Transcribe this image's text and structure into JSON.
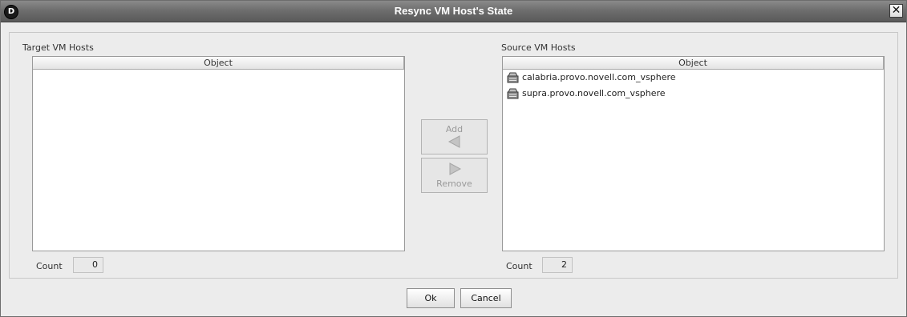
{
  "window": {
    "title": "Resync VM Host's State",
    "app_icon_letter": "D"
  },
  "target": {
    "label": "Target VM Hosts",
    "column_header": "Object",
    "items": [],
    "count_label": "Count",
    "count_value": "0"
  },
  "source": {
    "label": "Source VM Hosts",
    "column_header": "Object",
    "items": [
      {
        "label": "calabria.provo.novell.com_vsphere",
        "icon": "vm-host-icon"
      },
      {
        "label": "supra.provo.novell.com_vsphere",
        "icon": "vm-host-icon"
      }
    ],
    "count_label": "Count",
    "count_value": "2"
  },
  "actions": {
    "add_label": "Add",
    "remove_label": "Remove"
  },
  "footer": {
    "ok_label": "Ok",
    "cancel_label": "Cancel"
  },
  "colors": {
    "title_bar": "#6e6e6e",
    "disabled_text": "#9a9a9a"
  }
}
